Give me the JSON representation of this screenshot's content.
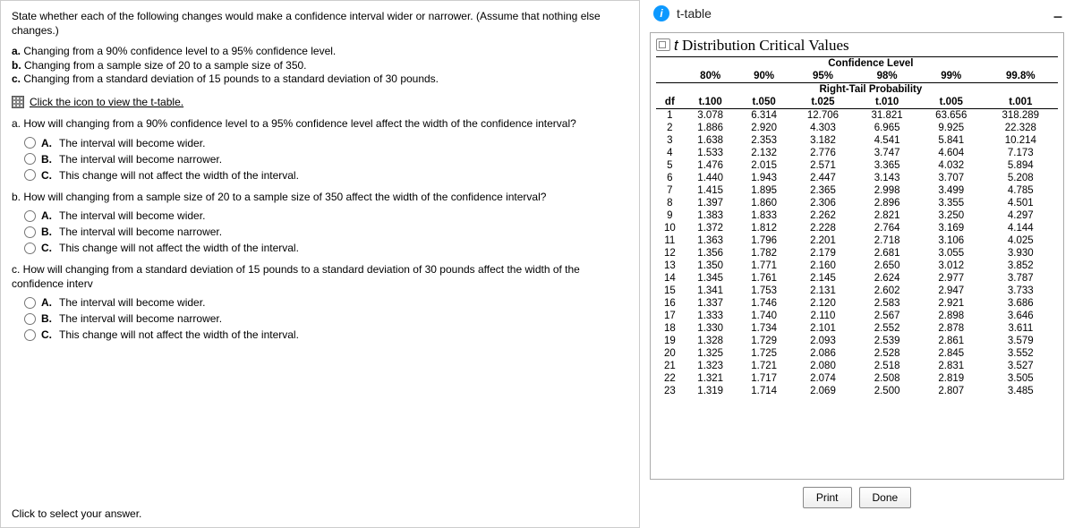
{
  "left": {
    "intro": "State whether each of the following changes would make a confidence interval wider or narrower. (Assume that nothing else changes.)",
    "items": {
      "a": "Changing from a 90% confidence level to a 95% confidence level.",
      "b": "Changing from a sample size of 20 to a sample size of 350.",
      "c": "Changing from a standard deviation of 15 pounds to a standard deviation of 30 pounds."
    },
    "click_link": "Click the icon to view the t-table.",
    "questions": {
      "a": {
        "text": "a. How will changing from a 90% confidence level to a 95% confidence level affect the width of the confidence interval?",
        "A": "The interval will become wider.",
        "B": "The interval will become narrower.",
        "C": "This change will not affect the width of the interval."
      },
      "b": {
        "text": "b. How will changing from a sample size of 20 to a sample size of 350 affect the width of the confidence interval?",
        "A": "The interval will become wider.",
        "B": "The interval will become narrower.",
        "C": "This change will not affect the width of the interval."
      },
      "c": {
        "text": "c. How will changing from a standard deviation of 15 pounds to a standard deviation of 30 pounds affect the width of the confidence interv",
        "A": "The interval will become wider.",
        "B": "The interval will become narrower.",
        "C": "This change will not affect the width of the interval."
      }
    },
    "footer": "Click to select your answer."
  },
  "modal": {
    "title": "t-table",
    "table_title": "t Distribution Critical Values",
    "conf_label": "Confidence Level",
    "tail_label": "Right-Tail Probability",
    "df_label": "df",
    "conf_levels": [
      "80%",
      "90%",
      "95%",
      "98%",
      "99%",
      "99.8%"
    ],
    "tail_probs": [
      "t.100",
      "t.050",
      "t.025",
      "t.010",
      "t.005",
      "t.001"
    ],
    "print": "Print",
    "done": "Done"
  },
  "menu_icon": "–",
  "chart_data": {
    "type": "table",
    "title": "t Distribution Critical Values",
    "columns": [
      "df",
      "t.100",
      "t.050",
      "t.025",
      "t.010",
      "t.005",
      "t.001"
    ],
    "rows": [
      [
        1,
        "3.078",
        "6.314",
        "12.706",
        "31.821",
        "63.656",
        "318.289"
      ],
      [
        2,
        "1.886",
        "2.920",
        "4.303",
        "6.965",
        "9.925",
        "22.328"
      ],
      [
        3,
        "1.638",
        "2.353",
        "3.182",
        "4.541",
        "5.841",
        "10.214"
      ],
      [
        4,
        "1.533",
        "2.132",
        "2.776",
        "3.747",
        "4.604",
        "7.173"
      ],
      [
        5,
        "1.476",
        "2.015",
        "2.571",
        "3.365",
        "4.032",
        "5.894"
      ],
      [
        6,
        "1.440",
        "1.943",
        "2.447",
        "3.143",
        "3.707",
        "5.208"
      ],
      [
        7,
        "1.415",
        "1.895",
        "2.365",
        "2.998",
        "3.499",
        "4.785"
      ],
      [
        8,
        "1.397",
        "1.860",
        "2.306",
        "2.896",
        "3.355",
        "4.501"
      ],
      [
        9,
        "1.383",
        "1.833",
        "2.262",
        "2.821",
        "3.250",
        "4.297"
      ],
      [
        10,
        "1.372",
        "1.812",
        "2.228",
        "2.764",
        "3.169",
        "4.144"
      ],
      [
        11,
        "1.363",
        "1.796",
        "2.201",
        "2.718",
        "3.106",
        "4.025"
      ],
      [
        12,
        "1.356",
        "1.782",
        "2.179",
        "2.681",
        "3.055",
        "3.930"
      ],
      [
        13,
        "1.350",
        "1.771",
        "2.160",
        "2.650",
        "3.012",
        "3.852"
      ],
      [
        14,
        "1.345",
        "1.761",
        "2.145",
        "2.624",
        "2.977",
        "3.787"
      ],
      [
        15,
        "1.341",
        "1.753",
        "2.131",
        "2.602",
        "2.947",
        "3.733"
      ],
      [
        16,
        "1.337",
        "1.746",
        "2.120",
        "2.583",
        "2.921",
        "3.686"
      ],
      [
        17,
        "1.333",
        "1.740",
        "2.110",
        "2.567",
        "2.898",
        "3.646"
      ],
      [
        18,
        "1.330",
        "1.734",
        "2.101",
        "2.552",
        "2.878",
        "3.611"
      ],
      [
        19,
        "1.328",
        "1.729",
        "2.093",
        "2.539",
        "2.861",
        "3.579"
      ],
      [
        20,
        "1.325",
        "1.725",
        "2.086",
        "2.528",
        "2.845",
        "3.552"
      ],
      [
        21,
        "1.323",
        "1.721",
        "2.080",
        "2.518",
        "2.831",
        "3.527"
      ],
      [
        22,
        "1.321",
        "1.717",
        "2.074",
        "2.508",
        "2.819",
        "3.505"
      ],
      [
        23,
        "1.319",
        "1.714",
        "2.069",
        "2.500",
        "2.807",
        "3.485"
      ]
    ]
  }
}
